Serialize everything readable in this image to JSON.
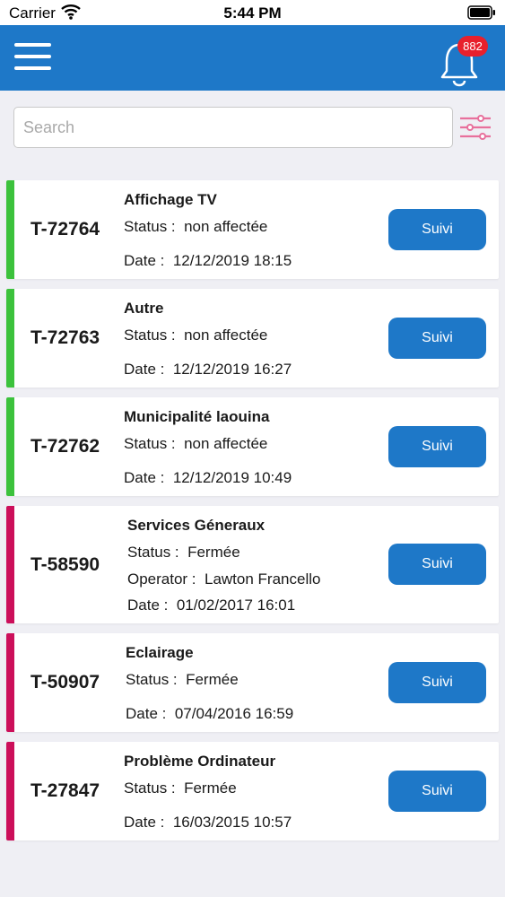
{
  "status_bar": {
    "carrier": "Carrier",
    "time": "5:44 PM"
  },
  "header": {
    "notification_count": "882",
    "accent_color": "#1e78c8",
    "badge_color": "#e8202c"
  },
  "search": {
    "placeholder": "Search",
    "value": ""
  },
  "colors": {
    "open_status": "#3cc23c",
    "closed_status": "#cc0f5a",
    "filter_icon": "#e8709c"
  },
  "tickets": [
    {
      "id": "T-72764",
      "title": "Affichage TV",
      "status_label": "Status :",
      "status": "non affectée",
      "date_label": "Date :",
      "date": "12/12/2019 18:15",
      "button": "Suivi",
      "status_color": "#3cc23c"
    },
    {
      "id": "T-72763",
      "title": "Autre",
      "status_label": "Status :",
      "status": "non affectée",
      "date_label": "Date :",
      "date": "12/12/2019 16:27",
      "button": "Suivi",
      "status_color": "#3cc23c"
    },
    {
      "id": "T-72762",
      "title": "Municipalité laouina",
      "status_label": "Status :",
      "status": "non affectée",
      "date_label": "Date :",
      "date": "12/12/2019 10:49",
      "button": "Suivi",
      "status_color": "#3cc23c"
    },
    {
      "id": "T-58590",
      "title": "Services Géneraux",
      "status_label": "Status :",
      "status": "Fermée",
      "operator_label": "Operator :",
      "operator": "Lawton Francello",
      "date_label": "Date :",
      "date": "01/02/2017 16:01",
      "button": "Suivi",
      "status_color": "#cc0f5a"
    },
    {
      "id": "T-50907",
      "title": "Eclairage",
      "status_label": "Status :",
      "status": "Fermée",
      "date_label": "Date :",
      "date": "07/04/2016 16:59",
      "button": "Suivi",
      "status_color": "#cc0f5a"
    },
    {
      "id": "T-27847",
      "title": "Problème Ordinateur",
      "status_label": "Status :",
      "status": "Fermée",
      "date_label": "Date :",
      "date": "16/03/2015 10:57",
      "button": "Suivi",
      "status_color": "#cc0f5a"
    }
  ]
}
